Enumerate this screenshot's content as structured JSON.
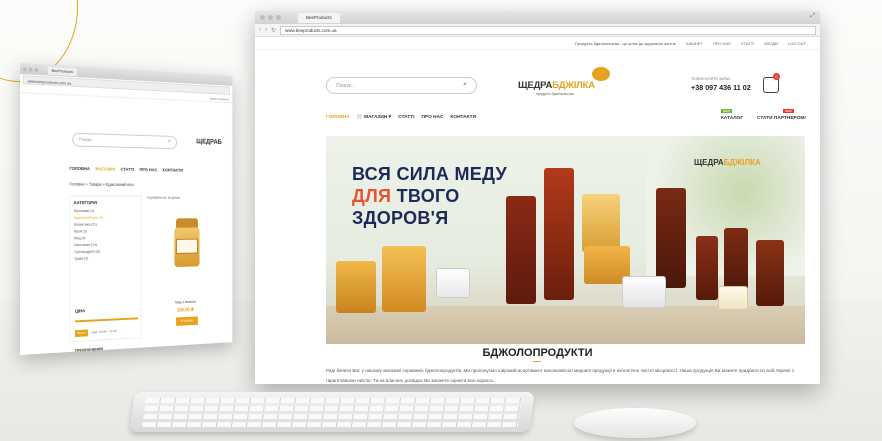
{
  "back_window": {
    "tab": "BeeProducts",
    "url": "www.beeproducts.com.ua",
    "top_text": "Бджолопродукти",
    "search_placeholder": "Пошук...",
    "logo": "ЩЕДРАБ",
    "nav": [
      "ГОЛОВНА",
      "МАГАЗИН",
      "СТАТТІ",
      "ПРО НАС",
      "КОНТАКТИ"
    ],
    "breadcrumbs": "Головна » Товари » Бджолиний віск",
    "category_title": "КАТЕГОРІЯ",
    "categories": [
      "Бальзами (1)",
      "Бджолиний віск (4)",
      "Косметика (21)",
      "Крем (3)",
      "Мед (4)",
      "Настоянки (14)",
      "Сухопродукти (6)",
      "Трави (4)"
    ],
    "sort_text": "Сортувати за: за ціною",
    "product_name": "Мед з пилком",
    "product_price": "100.00 ₴",
    "buy_label": "В кошик",
    "price_title": "ЦІНА",
    "price_range": "Ціна: 150 ₴ — 115 ₴",
    "filter_btn": "Фільтр",
    "adv_title": "ПРИЗНАЧЕННЯ"
  },
  "window": {
    "tab": "BeeProducts",
    "url": "www.beeproducts.com.ua",
    "top_promo": "Продукти бджільництва - це шлях до здорового життя!",
    "top_links": [
      "КАБІНЕТ",
      "ПРО НАС",
      "СТАТТІ",
      "ВХОДИ",
      "LOG OUT"
    ],
    "search_placeholder": "Пошук...",
    "logo_main": "ЩЕДРА",
    "logo_accent": "БДЖІЛКА",
    "logo_sub": "продукти бджільництва",
    "phone_label": "ТЕЛЕФОНУЙТЕ ЗАРАЗ",
    "phone": "+38 097 436 11 02",
    "cart_count": "0",
    "menu": [
      "ГОЛОВНА",
      "МАГАЗИН",
      "СТАТТІ",
      "ПРО НАС",
      "КОНТАКТИ"
    ],
    "badge_new": "NEW",
    "badge_new2": "NEW",
    "catalog": "КАТАЛОГ",
    "partners": "СТАТИ ПАРТНЕРОМ!",
    "banner_line1": "ВСЯ СИЛА МЕДУ",
    "banner_line2a": "ДЛЯ ",
    "banner_line2b": "ТВОГО",
    "banner_line3": "ЗДОРОВ'Я",
    "section_title": "БДЖОЛОПРОДУКТИ",
    "section_text": "Раді бачити Вас у нашому магазині справжніх бджолопродуктів. Ми пропонуємо широкий асортимент високоякісної медової продукції в екологічно чистої місцевості. Наша продукція Ви можете придбати по всій Україні з гарантованою якістю. Та на власних досвідах Ви зможете оцінити всю користь."
  },
  "colors": {
    "accent": "#e6a31e",
    "navy": "#1b2a5a",
    "red": "#e6542e"
  },
  "icons": [
    "search-icon",
    "cart-icon",
    "close-icon"
  ]
}
